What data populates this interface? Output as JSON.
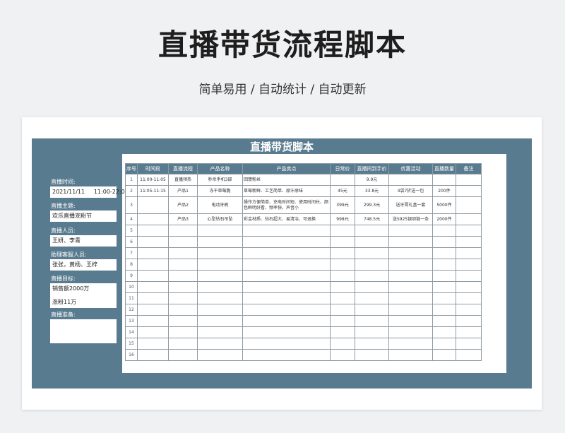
{
  "header": {
    "title": "直播带货流程脚本",
    "subtitle": "简单易用 / 自动统计 / 自动更新"
  },
  "sheet": {
    "title": "直播带货脚本",
    "panel": {
      "time_label": "直播时间:",
      "date": "2021/11/11",
      "time_range": "11:00-22:00",
      "topic_label": "直播主题:",
      "topic": "欢乐直播宠粉节",
      "host_label": "直播人员:",
      "host": "王妍、李青",
      "assistant_label": "助理客服人员:",
      "assistant": "张张，黄杨、王梓",
      "goal_label": "直播目标:",
      "goal_sales": "销售额2000万",
      "goal_fans": "涨粉11万",
      "prep_label": "直播准备:"
    },
    "columns": [
      "序号",
      "时间段",
      "直播流程",
      "产品名称",
      "产品卖点",
      "日常价",
      "直播间到手价",
      "优惠活动",
      "直播数量",
      "备注"
    ],
    "rows": [
      {
        "no": "1",
        "time": "11:00-11:05",
        "flow": "直播预热",
        "name": "秒杀手机3部",
        "point": "回馈粉丝",
        "price": "",
        "live_price": "9.9元",
        "promo": "",
        "qty": "",
        "note": ""
      },
      {
        "no": "2",
        "time": "11:05-11:15",
        "flow": "产品1",
        "name": "冻干草莓脆",
        "point": "草莓新鲜、工艺简单、原汁原味",
        "price": "45元",
        "live_price": "33.8元",
        "promo": "4袋7折送一包",
        "qty": "200件",
        "note": ""
      },
      {
        "no": "3",
        "time": "",
        "flow": "产品2",
        "name": "电动牙刷",
        "point": "操作方便简单、充电时间短、使用时间长、颜色鲜明好看、频率快、声音小",
        "price": "399元",
        "live_price": "299.3元",
        "promo": "送牙膏礼盒一套",
        "qty": "5000件",
        "note": ""
      },
      {
        "no": "4",
        "time": "",
        "flow": "产品3",
        "name": "心型钻石吊坠",
        "point": "彩金材质、钻石超大、易清洁、可退换",
        "price": "998元",
        "live_price": "748.5元",
        "promo": "送S925银项链一条",
        "qty": "2000件",
        "note": ""
      },
      {
        "no": "5"
      },
      {
        "no": "6"
      },
      {
        "no": "7"
      },
      {
        "no": "8"
      },
      {
        "no": "9"
      },
      {
        "no": "10"
      },
      {
        "no": "11"
      },
      {
        "no": "12"
      },
      {
        "no": "13"
      },
      {
        "no": "14"
      },
      {
        "no": "15"
      },
      {
        "no": "16"
      }
    ]
  },
  "colors": {
    "accent": "#597b8f",
    "page_background": "#f0f1f3"
  }
}
